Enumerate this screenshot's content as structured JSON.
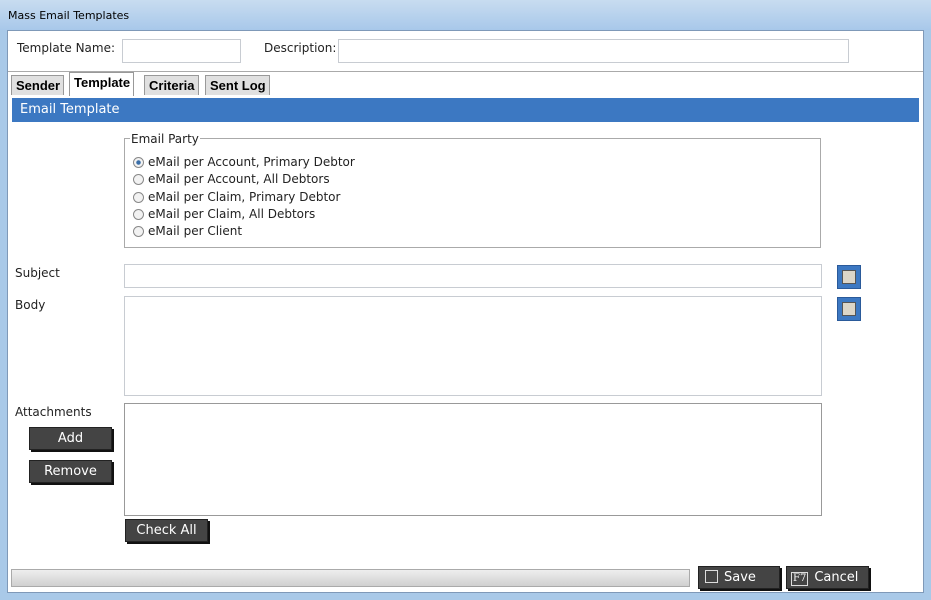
{
  "window": {
    "title": "Mass Email Templates"
  },
  "header": {
    "template_name_label": "Template Name:",
    "template_name_value": "",
    "description_label": "Description:",
    "description_value": ""
  },
  "tabs": [
    {
      "label": "Sender"
    },
    {
      "label": "Template",
      "active": true
    },
    {
      "label": "Criteria"
    },
    {
      "label": "Sent Log"
    }
  ],
  "section": {
    "title": "Email Template"
  },
  "email_party": {
    "legend": "Email Party",
    "options": [
      "eMail per Account, Primary Debtor",
      "eMail per Account, All Debtors",
      "eMail per Claim, Primary Debtor",
      "eMail per Claim, All Debtors",
      "eMail per Client"
    ],
    "selected": 0
  },
  "fields": {
    "subject_label": "Subject",
    "body_label": "Body",
    "attachments_label": "Attachments"
  },
  "buttons": {
    "add": "Add",
    "remove": "Remove",
    "check_all": "Check All",
    "save": "Save",
    "cancel": "Cancel",
    "cancel_key": "F7"
  },
  "colors": {
    "accent": "#3c78c2"
  }
}
